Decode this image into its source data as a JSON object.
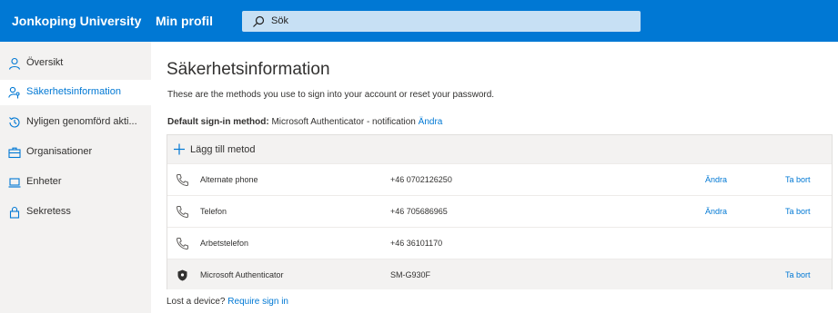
{
  "header": {
    "org_name": "Jonkoping University",
    "profile_link": "Min profil",
    "search_placeholder": "Sök",
    "background_color": "#0078d4"
  },
  "sidebar": {
    "items": [
      {
        "label": "Översikt",
        "icon": "person-icon",
        "active": false
      },
      {
        "label": "Säkerhetsinformation",
        "icon": "person-key-icon",
        "active": true
      },
      {
        "label": "Nyligen genomförd akti...",
        "icon": "history-icon",
        "active": false
      },
      {
        "label": "Organisationer",
        "icon": "briefcase-icon",
        "active": false
      },
      {
        "label": "Enheter",
        "icon": "laptop-icon",
        "active": false
      },
      {
        "label": "Sekretess",
        "icon": "lock-icon",
        "active": false
      }
    ]
  },
  "main": {
    "title": "Säkerhetsinformation",
    "subtitle": "These are the methods you use to sign into your account or reset your password.",
    "default_label": "Default sign-in method:",
    "default_value": "Microsoft Authenticator - notification",
    "default_change": "Ändra",
    "add_method": "Lägg till metod",
    "methods": [
      {
        "name": "Alternate phone",
        "value": "+46 0702126250",
        "change": "Ändra",
        "delete": "Ta bort",
        "icon": "phone-icon"
      },
      {
        "name": "Telefon",
        "value": "+46 705686965",
        "change": "Ändra",
        "delete": "Ta bort",
        "icon": "phone-icon"
      },
      {
        "name": "Arbetstelefon",
        "value": "+46 36101170",
        "change": "",
        "delete": "",
        "icon": "phone-icon"
      },
      {
        "name": "Microsoft Authenticator",
        "value": "SM-G930F",
        "change": "",
        "delete": "Ta bort",
        "icon": "authenticator-icon"
      }
    ],
    "lost_device_text": "Lost a device?",
    "require_sign_in": "Require sign in"
  },
  "colors": {
    "accent": "#0078d4",
    "sidebar_bg": "#f3f2f1",
    "text": "#323130"
  }
}
